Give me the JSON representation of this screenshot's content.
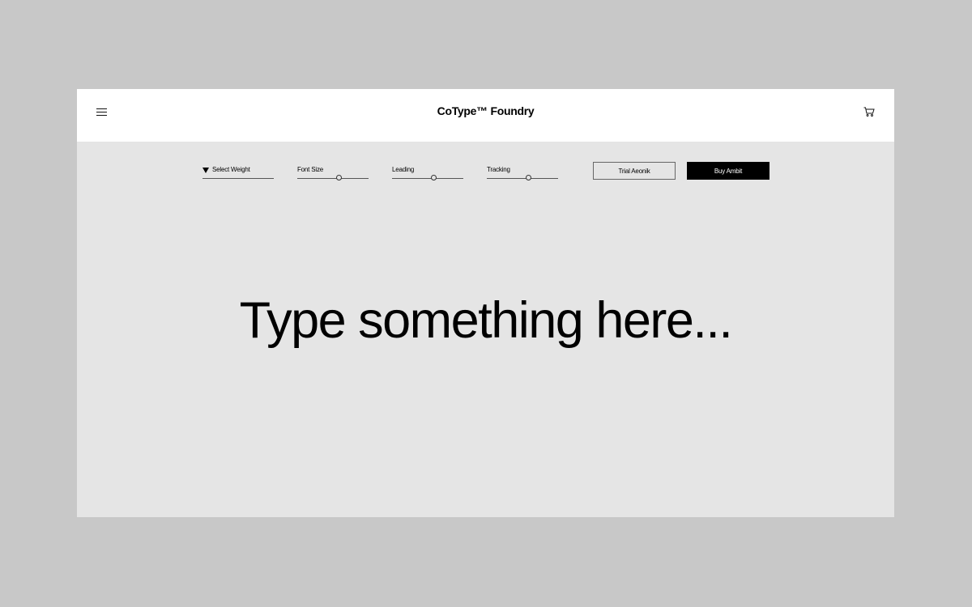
{
  "header": {
    "brand": "CoType™ Foundry",
    "menu_icon": "hamburger-menu-icon",
    "cart_icon": "shopping-cart-icon"
  },
  "toolbar": {
    "weight_select": {
      "label": "Select Weight",
      "icon": "triangle-down-icon"
    },
    "font_size": {
      "label": "Font Size",
      "value": 0.58
    },
    "leading": {
      "label": "Leading",
      "value": 0.58
    },
    "tracking": {
      "label": "Tracking",
      "value": 0.58
    },
    "trial_button": "Trial Aeonik",
    "buy_button": "Buy Ambit"
  },
  "preview": {
    "placeholder": "Type something here..."
  },
  "colors": {
    "backdrop": "#c8c8c8",
    "canvas": "#e5e5e5",
    "header": "#ffffff",
    "accent": "#000000"
  }
}
